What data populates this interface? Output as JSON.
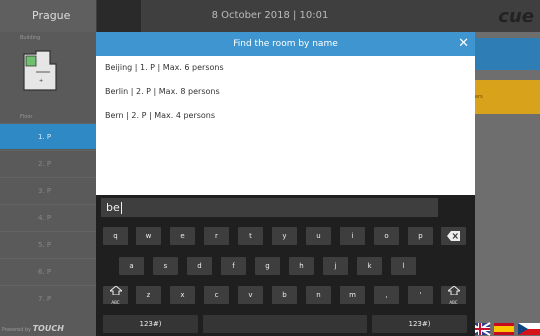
{
  "topbar": {
    "city": "Prague",
    "datetime": "8 October 2018  |  10:01",
    "logo": "cue"
  },
  "sidebar": {
    "building_label": "Building",
    "floor_label": "Floor",
    "floors": [
      {
        "label": "1. P",
        "active": true
      },
      {
        "label": "2. P",
        "active": false
      },
      {
        "label": "3. P",
        "active": false
      },
      {
        "label": "4. P",
        "active": false
      },
      {
        "label": "5. P",
        "active": false
      },
      {
        "label": "6. P",
        "active": false
      },
      {
        "label": "7. P",
        "active": false
      }
    ],
    "powered_prefix": "Powered by",
    "powered_brand": "TOUCH"
  },
  "accents": {
    "blue": "#2f7db5",
    "yellow": "#d8a21a",
    "yellow_text": "ers"
  },
  "modal": {
    "title": "Find the room by name",
    "rooms": [
      "Beijing | 1. P | Max. 6 persons",
      "Berlin | 2. P | Max. 8 persons",
      "Bern | 2. P | Max. 4 persons"
    ]
  },
  "search": {
    "value": "be"
  },
  "keyboard": {
    "row1": [
      "q",
      "w",
      "e",
      "r",
      "t",
      "y",
      "u",
      "i",
      "o",
      "p"
    ],
    "row2": [
      "a",
      "s",
      "d",
      "f",
      "g",
      "h",
      "j",
      "k",
      "l"
    ],
    "row3": [
      "z",
      "x",
      "c",
      "v",
      "b",
      "n",
      "m",
      ",",
      "'"
    ],
    "shift_label": "ABC",
    "mode_label": "123#)"
  }
}
